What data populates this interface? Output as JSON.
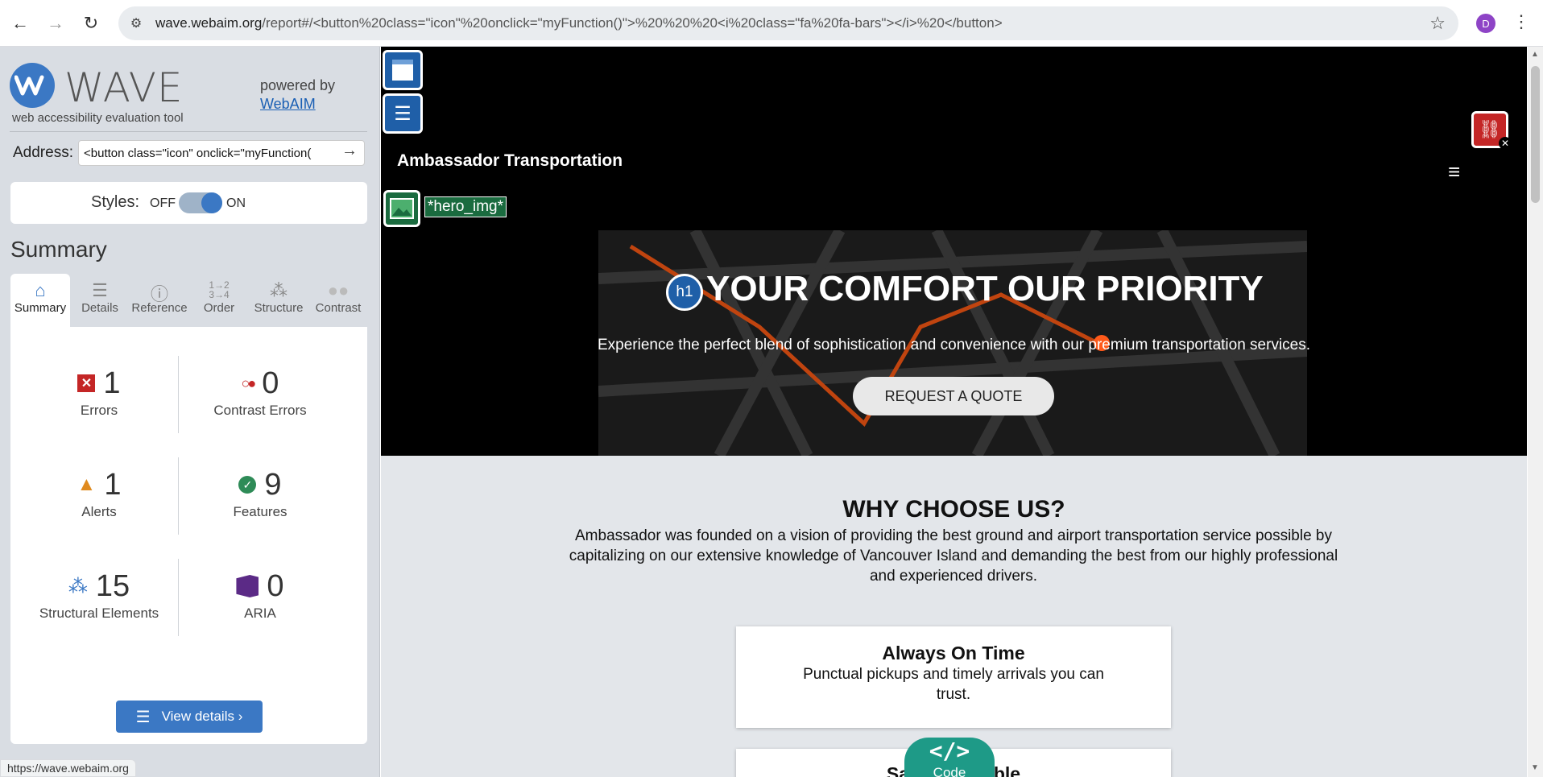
{
  "browser": {
    "url_host": "wave.webaim.org",
    "url_path": "/report#/<button%20class=\"icon\"%20onclick=\"myFunction()\">%20%20%20<i%20class=\"fa%20fa-bars\"></i>%20</button>",
    "profile_initial": "D",
    "status_url": "https://wave.webaim.org"
  },
  "wave": {
    "logo_word": "WAVE",
    "tagline": "web accessibility evaluation tool",
    "powered_by": "powered by",
    "webaim_link": "WebAIM",
    "address_label": "Address:",
    "address_value": "<button class=\"icon\" onclick=\"myFunction(",
    "styles_label": "Styles:",
    "styles_off": "OFF",
    "styles_on": "ON",
    "styles_state": "ON",
    "summary_heading": "Summary",
    "tabs": [
      {
        "label": "Summary",
        "icon": "home-icon"
      },
      {
        "label": "Details",
        "icon": "list-icon"
      },
      {
        "label": "Reference",
        "icon": "info-icon"
      },
      {
        "label": "Order",
        "icon": "order-icon"
      },
      {
        "label": "Structure",
        "icon": "structure-icon"
      },
      {
        "label": "Contrast",
        "icon": "contrast-icon"
      }
    ],
    "stats": {
      "errors": {
        "value": "1",
        "label": "Errors"
      },
      "contrast_errors": {
        "value": "0",
        "label": "Contrast Errors"
      },
      "alerts": {
        "value": "1",
        "label": "Alerts"
      },
      "features": {
        "value": "9",
        "label": "Features"
      },
      "structural": {
        "value": "15",
        "label": "Structural Elements"
      },
      "aria": {
        "value": "0",
        "label": "ARIA"
      }
    },
    "view_details": "View details ›"
  },
  "page": {
    "brand": "Ambassador Transportation",
    "hero_img_label": "*hero_img*",
    "h1_badge": "h1",
    "hero_title": "YOUR COMFORT OUR PRIORITY",
    "hero_subtitle": "Experience the perfect blend of sophistication and convenience with our premium transportation services.",
    "quote_button": "REQUEST A QUOTE",
    "why_title": "WHY CHOOSE US?",
    "why_body": "Ambassador was founded on a vision of providing the best ground and airport transportation service possible by capitalizing on our extensive knowledge of Vancouver Island and demanding the best from our highly professional and experienced drivers.",
    "card1_title": "Always On Time",
    "card1_body": "Punctual pickups and timely arrivals you can trust.",
    "card2_title": "Safe & Reliable",
    "code_icon": "</>",
    "code_label": "Code"
  },
  "colors": {
    "wave_blue": "#3b78c4",
    "error_red": "#c42626",
    "alert_orange": "#e08a1e",
    "feature_green": "#2e8b57",
    "aria_purple": "#5b2a86",
    "code_teal": "#1e9a87"
  }
}
